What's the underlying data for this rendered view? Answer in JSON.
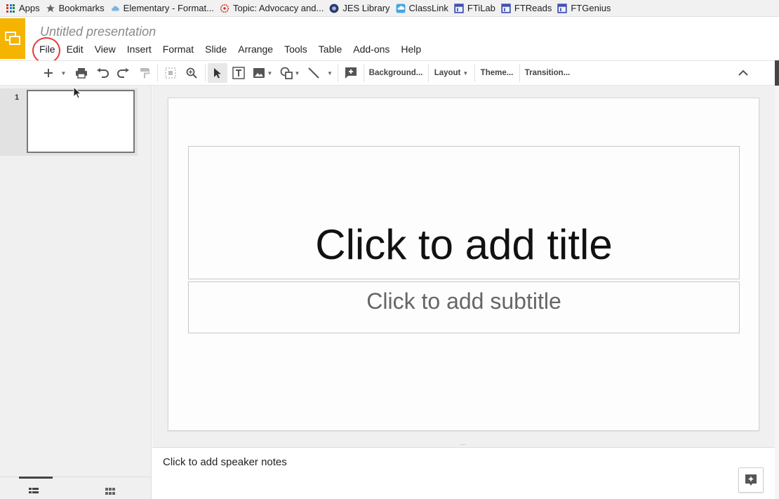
{
  "bookmarks": [
    {
      "label": "Apps",
      "icon": "apps-grid-icon"
    },
    {
      "label": "Bookmarks",
      "icon": "star-icon"
    },
    {
      "label": "Elementary - Format...",
      "icon": "cloud-icon"
    },
    {
      "label": "Topic: Advocacy and...",
      "icon": "badge-icon"
    },
    {
      "label": "JES Library",
      "icon": "library-icon"
    },
    {
      "label": "ClassLink",
      "icon": "classlink-icon"
    },
    {
      "label": "FTiLab",
      "icon": "ft-icon"
    },
    {
      "label": "FTReads",
      "icon": "ft-icon"
    },
    {
      "label": "FTGenius",
      "icon": "ft-icon"
    }
  ],
  "header": {
    "title": "Untitled presentation",
    "logo_color": "#f4b400"
  },
  "menu": [
    "File",
    "Edit",
    "View",
    "Insert",
    "Format",
    "Slide",
    "Arrange",
    "Tools",
    "Table",
    "Add-ons",
    "Help"
  ],
  "toolbar": {
    "background": "Background...",
    "layout": "Layout",
    "theme": "Theme...",
    "transition": "Transition..."
  },
  "filmstrip": {
    "slides": [
      {
        "number": "1"
      }
    ]
  },
  "slide": {
    "title_placeholder": "Click to add title",
    "subtitle_placeholder": "Click to add subtitle"
  },
  "notes": {
    "placeholder": "Click to add speaker notes"
  },
  "colors": {
    "highlight_ring": "#e53935",
    "ft_icon": "#3f51b5"
  }
}
